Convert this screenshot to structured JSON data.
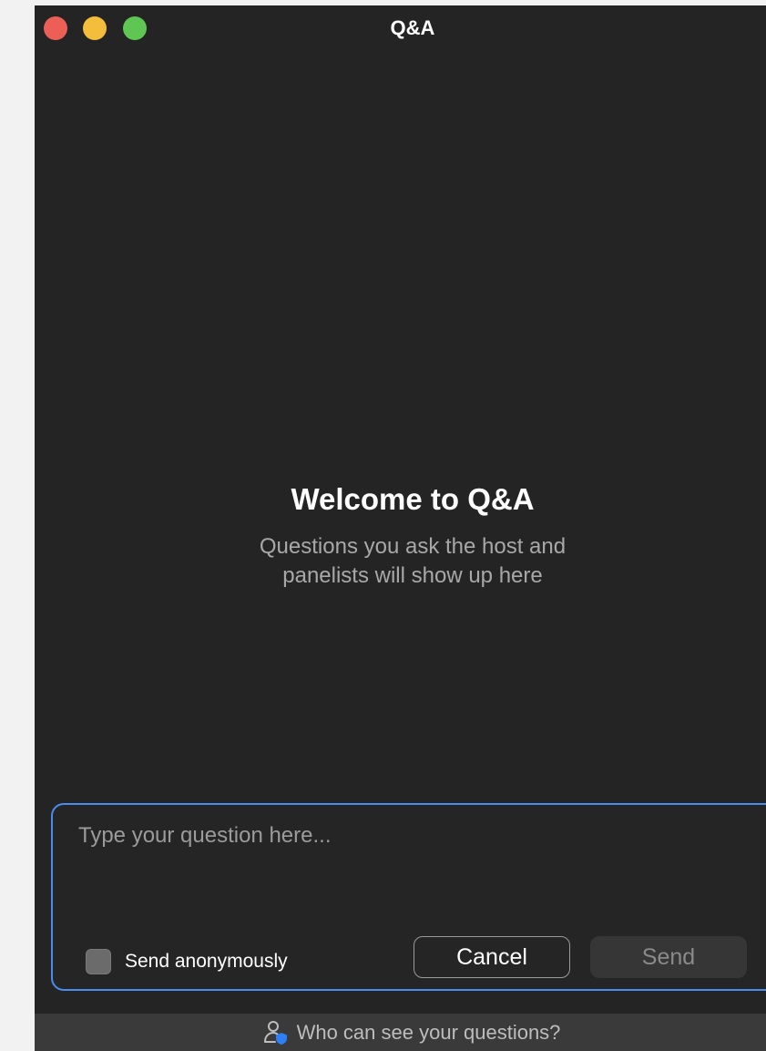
{
  "window": {
    "title": "Q&A"
  },
  "empty_state": {
    "heading": "Welcome to Q&A",
    "subtitle": "Questions you ask the host and panelists will show up here"
  },
  "composer": {
    "placeholder": "Type your question here...",
    "value": "",
    "anonymous_label": "Send anonymously",
    "anonymous_checked": false,
    "cancel_label": "Cancel",
    "send_label": "Send"
  },
  "footer": {
    "link_label": "Who can see your questions?",
    "icon": "person-shield-icon"
  },
  "colors": {
    "background": "#242424",
    "accent": "#4a8cf0",
    "close": "#ec5f57",
    "minimize": "#f4bd3c",
    "maximize": "#5fc553"
  }
}
